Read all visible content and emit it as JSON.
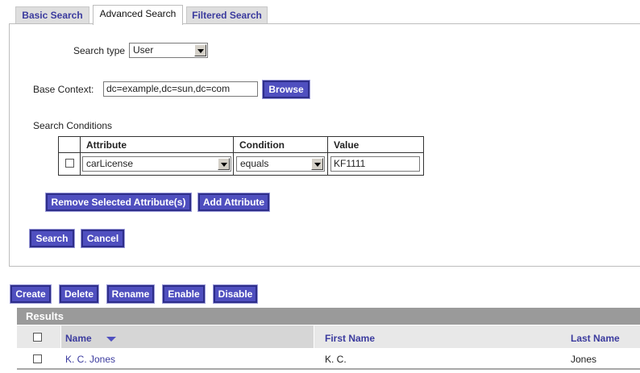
{
  "tabs": [
    {
      "label": "Basic Search"
    },
    {
      "label": "Advanced Search"
    },
    {
      "label": "Filtered Search"
    }
  ],
  "form": {
    "search_type_label": "Search type",
    "search_type_value": "User",
    "base_context_label": "Base Context:",
    "base_context_value": "dc=example,dc=sun,dc=com",
    "browse_label": "Browse",
    "conditions_label": "Search Conditions",
    "conditions": {
      "headers": [
        "Attribute",
        "Condition",
        "Value"
      ],
      "row": {
        "attribute": "carLicense",
        "condition": "equals",
        "value": "KF1111"
      }
    },
    "remove_label": "Remove Selected Attribute(s)",
    "add_label": "Add Attribute",
    "search_label": "Search",
    "cancel_label": "Cancel"
  },
  "actions": {
    "create": "Create",
    "delete": "Delete",
    "rename": "Rename",
    "enable": "Enable",
    "disable": "Disable"
  },
  "results": {
    "title": "Results",
    "columns": [
      "Name",
      "First Name",
      "Last Name"
    ],
    "rows": [
      {
        "name": "K. C. Jones",
        "first": "K. C.",
        "last": "Jones"
      }
    ]
  },
  "colors": {
    "button_bg": "#4f4fbf",
    "link": "#3b3b9e",
    "results_bar": "#9a9a9a"
  }
}
